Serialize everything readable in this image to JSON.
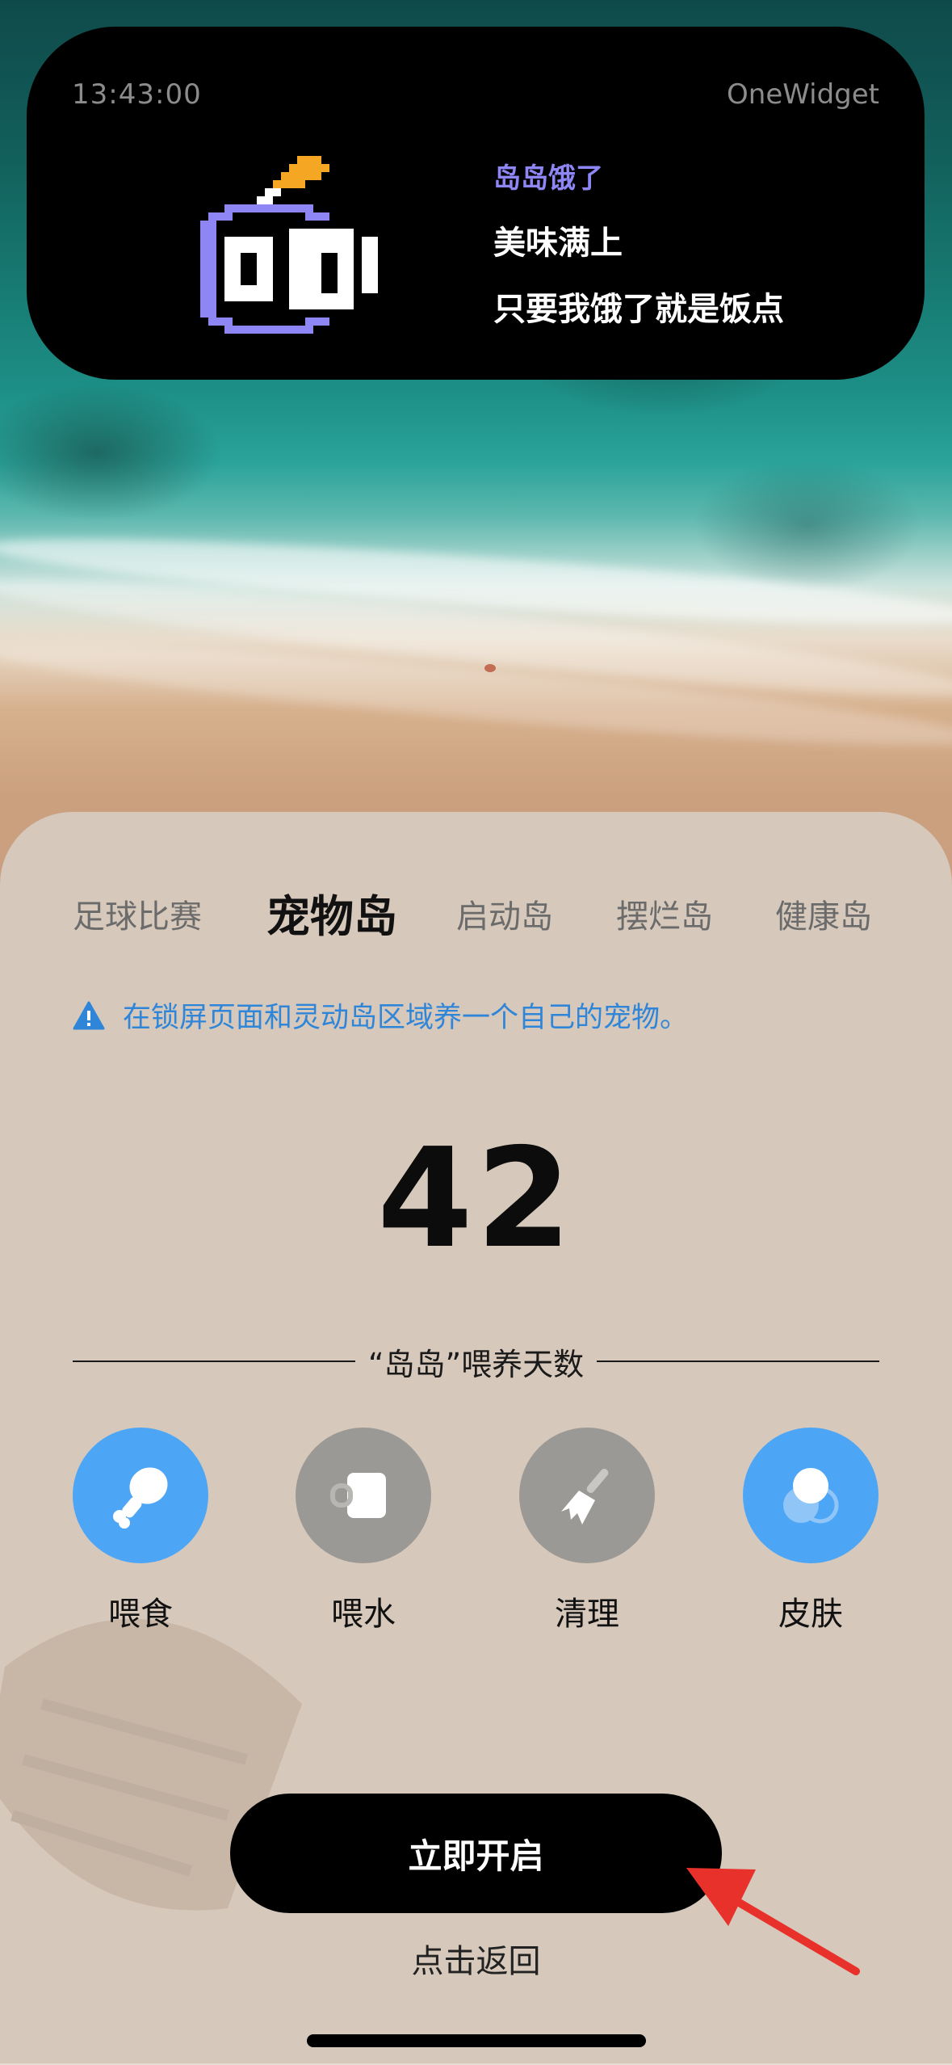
{
  "island": {
    "time": "13:43:00",
    "brand": "OneWidget",
    "title": "岛岛饿了",
    "line1": "美味满上",
    "line2": "只要我饿了就是饭点",
    "pet_icon": "pixel-pet-icon"
  },
  "tabs": [
    {
      "label": "足球比赛",
      "active": false
    },
    {
      "label": "宠物岛",
      "active": true
    },
    {
      "label": "启动岛",
      "active": false
    },
    {
      "label": "摆烂岛",
      "active": false
    },
    {
      "label": "健康岛",
      "active": false
    }
  ],
  "notice": {
    "icon": "warning-icon",
    "text": "在锁屏页面和灵动岛区域养一个自己的宠物。",
    "color": "#2f86d9"
  },
  "stats": {
    "days": "42",
    "label": "“岛岛”喂养天数"
  },
  "actions": [
    {
      "label": "喂食",
      "icon": "drumstick-icon",
      "active": true
    },
    {
      "label": "喂水",
      "icon": "cup-icon",
      "active": false
    },
    {
      "label": "清理",
      "icon": "broom-icon",
      "active": false
    },
    {
      "label": "皮肤",
      "icon": "skin-icon",
      "active": true
    }
  ],
  "buttons": {
    "enable": "立即开启",
    "back": "点击返回"
  },
  "colors": {
    "accent": "#4da6f5",
    "inactive": "#9b9995",
    "sheet": "#d6c8bb",
    "annotation_arrow": "#e8312a"
  }
}
